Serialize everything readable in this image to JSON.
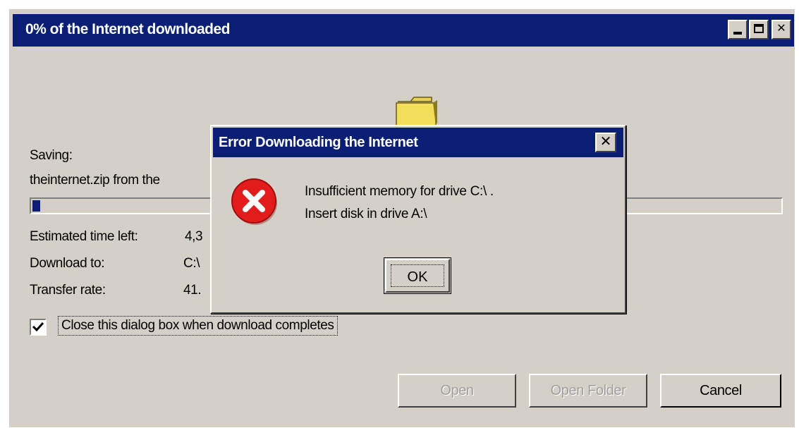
{
  "main_window": {
    "title": "0% of the Internet downloaded",
    "saving_label": "Saving:",
    "saving_file": "theinternet.zip from the",
    "progress": 0.01,
    "fields": [
      {
        "label": "Estimated time left:",
        "value": "4,3"
      },
      {
        "label": "Download to:",
        "value": "C:\\"
      },
      {
        "label": "Transfer rate:",
        "value": "41."
      }
    ],
    "close_when_done_label": "Close this dialog box when download completes",
    "close_when_done_checked": true,
    "buttons": {
      "open": "Open",
      "open_folder": "Open Folder",
      "cancel": "Cancel"
    }
  },
  "error_dialog": {
    "title": "Error Downloading the Internet",
    "icon": "error-icon",
    "message_line1": "Insufficient memory for drive C:\\ .",
    "message_line2": "Insert disk in drive A:\\",
    "ok_label": "OK"
  },
  "colors": {
    "titlebar": "#0a1e73",
    "face": "#d4d0c8",
    "error_red": "#e21b1b"
  }
}
